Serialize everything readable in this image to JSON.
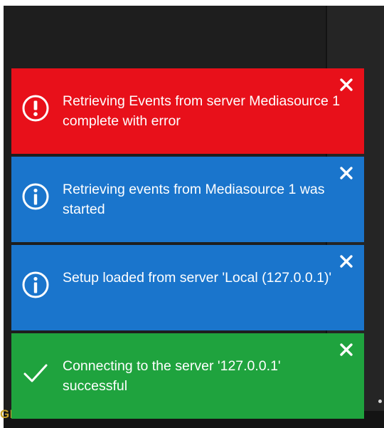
{
  "app": {
    "brand": "GEUTEBRUCK"
  },
  "colors": {
    "error": "#e8101a",
    "info": "#1a75cc",
    "success": "#1fa33e",
    "background": "#1e1e1e",
    "brand": "#c9a227"
  },
  "notifications": [
    {
      "type": "error",
      "icon": "error-circle-icon",
      "message": "Retrieving Events from server Mediasource 1 complete with error"
    },
    {
      "type": "info",
      "icon": "info-circle-icon",
      "message": "Retrieving events from Mediasource 1 was started"
    },
    {
      "type": "info",
      "icon": "info-circle-icon",
      "message": "Setup loaded from server 'Local (127.0.0.1)'"
    },
    {
      "type": "success",
      "icon": "checkmark-icon",
      "message": "Connecting to the server '127.0.0.1' successful"
    }
  ]
}
